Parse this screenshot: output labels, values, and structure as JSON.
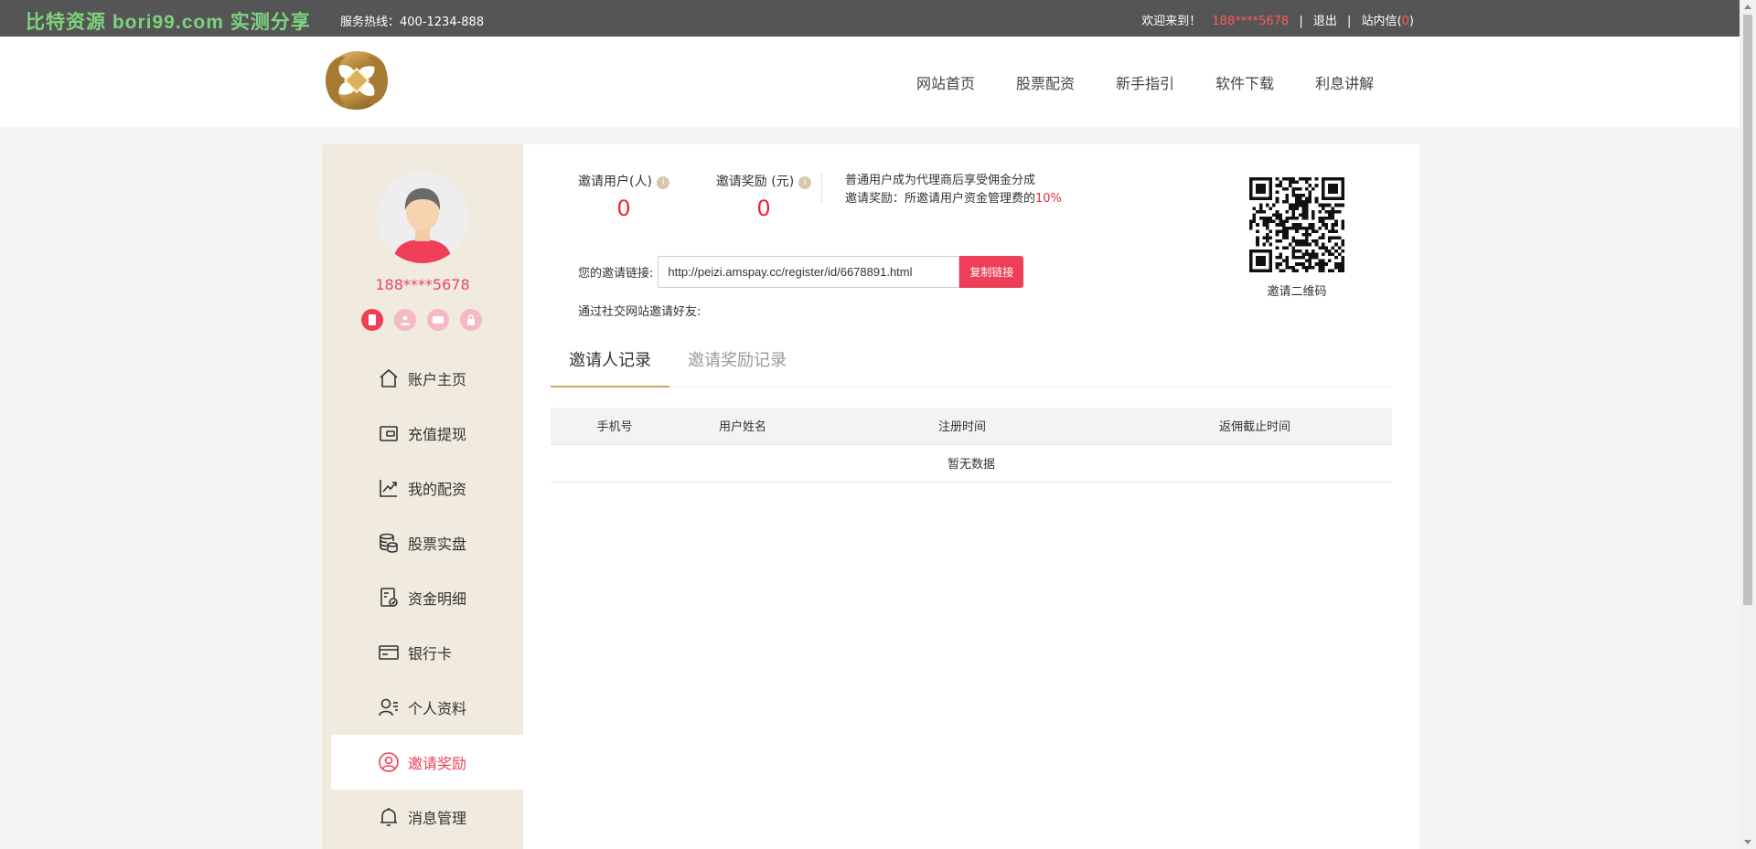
{
  "topbar": {
    "brand": "比特资源 bori99.com 实测分享",
    "hotline": "服务热线：400-1234-888",
    "welcome": "欢迎来到！",
    "phone": "188****5678",
    "logout": "退出",
    "sep1": "|",
    "sep2": "|",
    "inbox_label": "站内信",
    "inbox_open": "(",
    "inbox_count": "0",
    "inbox_close": ")"
  },
  "nav": {
    "items": [
      "网站首页",
      "股票配资",
      "新手指引",
      "软件下载",
      "利息讲解"
    ]
  },
  "sidebar": {
    "username": "188****5678",
    "menu": [
      "账户主页",
      "充值提现",
      "我的配资",
      "股票实盘",
      "资金明细",
      "银行卡",
      "个人资料",
      "邀请奖励",
      "消息管理"
    ]
  },
  "stats": {
    "invited_users_label": "邀请用户(人)",
    "invited_users_value": "0",
    "reward_label": "邀请奖励 (元)",
    "reward_value": "0",
    "info_icon": "i"
  },
  "description": {
    "line1": "普通用户成为代理商后享受佣金分成",
    "line2_prefix": "邀请奖励：所邀请用户资金管理费的",
    "line2_rate": "10%"
  },
  "invite": {
    "link_label": "您的邀请链接:",
    "link_value": "http://peizi.amspay.cc/register/id/6678891.html",
    "copy_button": "复制链接",
    "social_label": "通过社交网站邀请好友:",
    "qr_label": "邀请二维码"
  },
  "tabs": [
    "邀请人记录",
    "邀请奖励记录"
  ],
  "table": {
    "headers": [
      "手机号",
      "用户姓名",
      "注册时间",
      "返佣截止时间"
    ],
    "empty": "暂无数据"
  },
  "colors": {
    "accent": "#ee3e58",
    "sidebar_bg": "#f0eadf",
    "topbar_bg": "#555555",
    "gold": "#c9a46b"
  }
}
